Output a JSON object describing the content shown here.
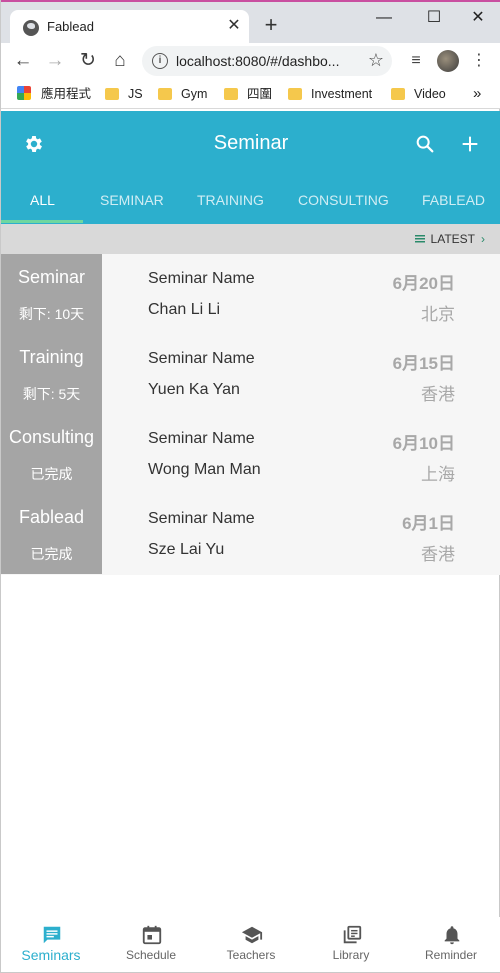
{
  "browser": {
    "tab_title": "Fablead",
    "url": "localhost:8080/#/dashbo...",
    "bookmarks": [
      "應用程式",
      "JS",
      "Gym",
      "四圍",
      "Investment",
      "Video"
    ]
  },
  "header": {
    "title": "Seminar",
    "tabs": [
      "ALL",
      "SEMINAR",
      "TRAINING",
      "CONSULTING",
      "FABLEAD"
    ],
    "active_tab": "ALL",
    "accent_color": "#2cafcd"
  },
  "sort": {
    "label": "LATEST"
  },
  "seminars": [
    {
      "type": "Seminar",
      "status": "剩下: 10天",
      "name": "Seminar Name",
      "person": "Chan Li Li",
      "date": "6月20日",
      "location": "北京"
    },
    {
      "type": "Training",
      "status": "剩下: 5天",
      "name": "Seminar Name",
      "person": "Yuen Ka Yan",
      "date": "6月15日",
      "location": "香港"
    },
    {
      "type": "Consulting",
      "status": "已完成",
      "name": "Seminar Name",
      "person": "Wong Man Man",
      "date": "6月10日",
      "location": "上海"
    },
    {
      "type": "Fablead",
      "status": "已完成",
      "name": "Seminar Name",
      "person": "Sze Lai Yu",
      "date": "6月1日",
      "location": "香港"
    }
  ],
  "bottom_nav": [
    {
      "label": "Seminars",
      "icon": "chat-icon"
    },
    {
      "label": "Schedule",
      "icon": "calendar-icon"
    },
    {
      "label": "Teachers",
      "icon": "school-icon"
    },
    {
      "label": "Library",
      "icon": "library-icon"
    },
    {
      "label": "Reminder",
      "icon": "bell-icon"
    }
  ],
  "bottom_nav_active": "Seminars"
}
